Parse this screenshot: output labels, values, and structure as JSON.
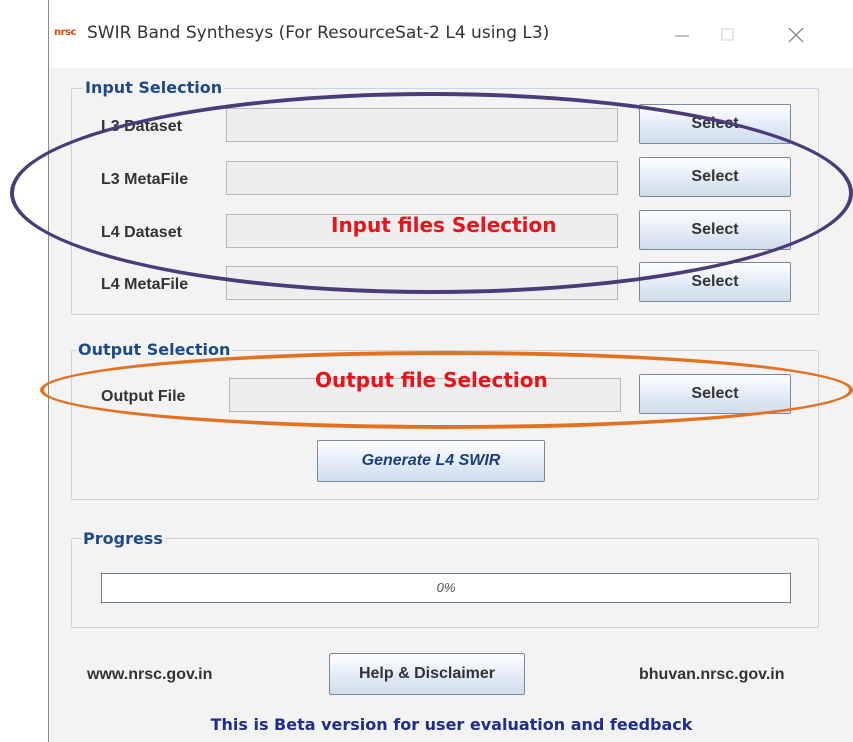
{
  "window": {
    "app_icon": "nrsc",
    "title": "SWIR Band Synthesys (For ResourceSat-2 L4 using L3)",
    "controls": [
      "minimize-icon",
      "maximize-icon",
      "close-icon"
    ]
  },
  "input_selection": {
    "title": "Input Selection",
    "rows": [
      {
        "label": "L3 Dataset",
        "value": "",
        "button": "Select"
      },
      {
        "label": "L3 MetaFile",
        "value": "",
        "button": "Select"
      },
      {
        "label": "L4 Dataset",
        "value": "",
        "button": "Select"
      },
      {
        "label": "L4 MetaFile",
        "value": "",
        "button": "Select"
      }
    ]
  },
  "output_selection": {
    "title": "Output Selection",
    "label": "Output File",
    "value": "",
    "button": "Select"
  },
  "generate_button": "Generate L4 SWIR",
  "progress": {
    "title": "Progress",
    "text": "0%",
    "fraction": 0
  },
  "footer": {
    "left_link": "www.nrsc.gov.in",
    "help_button": "Help & Disclaimer",
    "right_link": "bhuvan.nrsc.gov.in",
    "beta_notice": "This is Beta version for user evaluation and feedback"
  },
  "annotations": {
    "input": "Input files Selection",
    "output": "Output file Selection",
    "input_color": "#4b3b7a",
    "output_color": "#e3711f",
    "text_color": "#e8141b"
  }
}
